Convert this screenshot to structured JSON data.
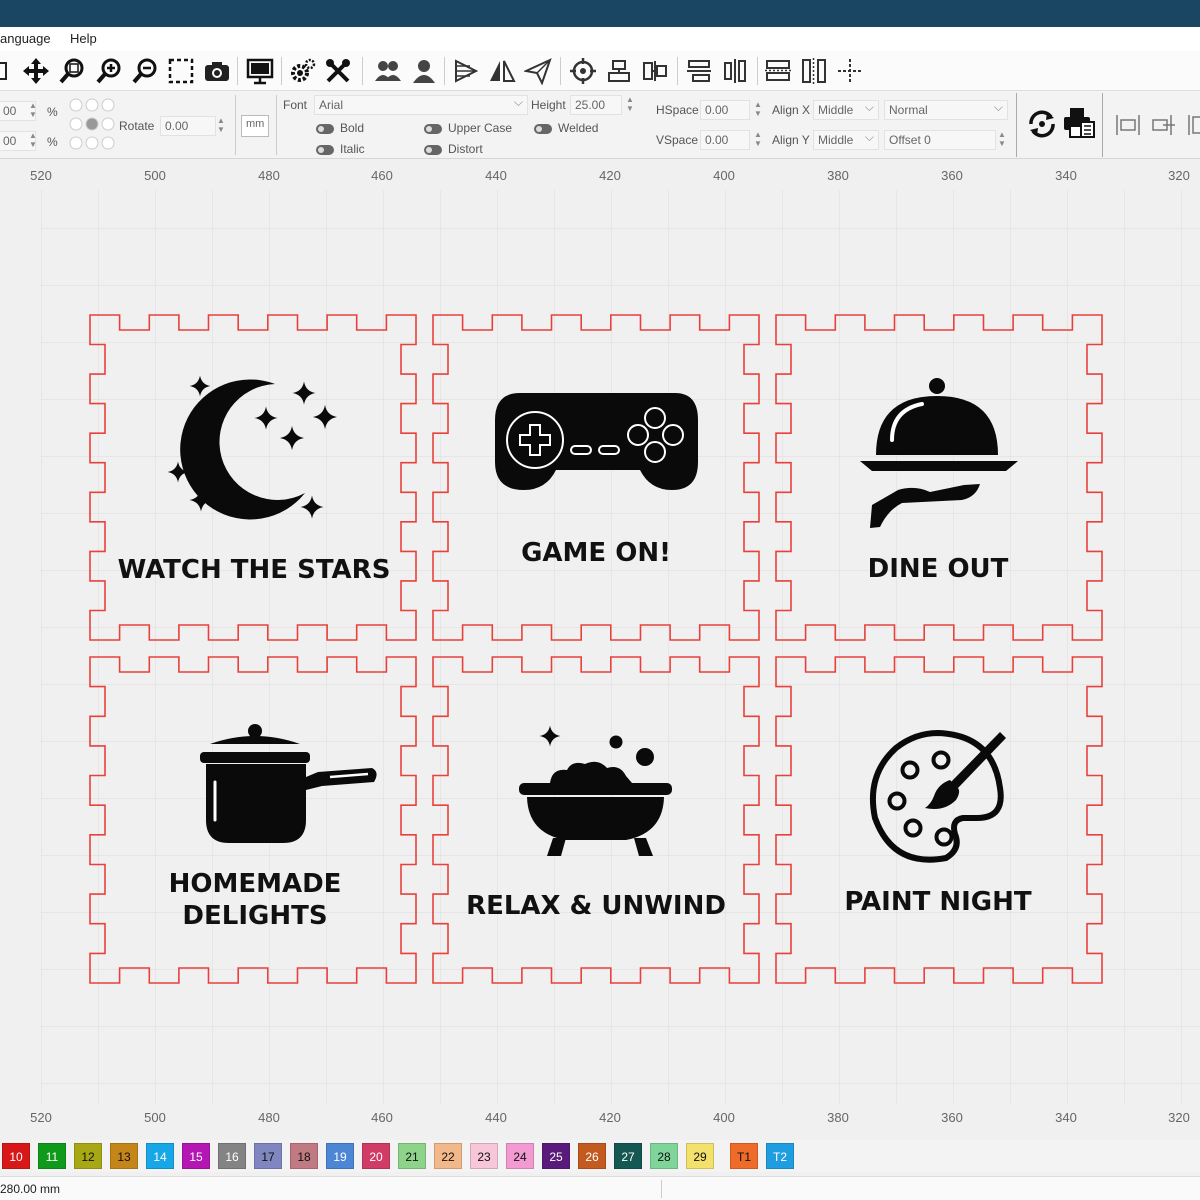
{
  "menu": {
    "language": "anguage",
    "help": "Help"
  },
  "toolbar": {
    "icons": [
      "open-icon",
      "move-icon",
      "zoom-fit-icon",
      "zoom-in-icon",
      "zoom-out-icon",
      "select-rect-icon",
      "camera-icon",
      "monitor-icon",
      "settings-icon",
      "tools-icon",
      "group-icon",
      "user-icon",
      "flip-horizontal-icon",
      "mirror-icon",
      "send-icon",
      "target-icon",
      "align-top-icon",
      "align-side-icon",
      "distribute-h-icon",
      "distribute-v-icon",
      "array-icon",
      "spacing-icon",
      "crosshair-icon"
    ]
  },
  "textbar": {
    "pos_x": "00",
    "pos_y": "00",
    "pct1": "%",
    "pct2": "%",
    "rotate_label": "Rotate",
    "rotate_value": "0.00",
    "unit": "mm",
    "font_label": "Font",
    "font_value": "Arial",
    "height_label": "Height",
    "height_value": "25.00",
    "hspace_label": "HSpace",
    "hspace_value": "0.00",
    "vspace_label": "VSpace",
    "vspace_value": "0.00",
    "alignx_label": "Align X",
    "alignx_value": "Middle",
    "aligny_label": "Align Y",
    "aligny_value": "Middle",
    "mode_value": "Normal",
    "offset_label": "Offset",
    "offset_value": "0",
    "bold": "Bold",
    "italic": "Italic",
    "upper_case": "Upper Case",
    "distort": "Distort",
    "welded": "Welded"
  },
  "ruler": {
    "ticks": [
      "520",
      "500",
      "480",
      "460",
      "440",
      "420",
      "400",
      "380",
      "360",
      "340",
      "320"
    ]
  },
  "cards": [
    {
      "title": "WATCH THE STARS",
      "icon": "moon-stars-icon"
    },
    {
      "title": "GAME ON!",
      "icon": "gamepad-icon"
    },
    {
      "title": "DINE OUT",
      "icon": "cloche-icon"
    },
    {
      "title_line1": "HOMEMADE",
      "title_line2": "DELIGHTS",
      "icon": "cooking-pot-icon"
    },
    {
      "title": "RELAX & UNWIND",
      "icon": "bathtub-icon"
    },
    {
      "title": "PAINT NIGHT",
      "icon": "palette-icon"
    }
  ],
  "colors": {
    "cut_line": "#e8413c",
    "icon_fill": "#0a0a0a",
    "titlebar": "#1a4563"
  },
  "palette": [
    {
      "label": "10",
      "color": "#d81818",
      "fg": "#fff"
    },
    {
      "label": "11",
      "color": "#0f9a1b",
      "fg": "#fff"
    },
    {
      "label": "12",
      "color": "#a8a814",
      "fg": "#111"
    },
    {
      "label": "13",
      "color": "#c4861a",
      "fg": "#111"
    },
    {
      "label": "14",
      "color": "#17a7e6",
      "fg": "#fff"
    },
    {
      "label": "15",
      "color": "#b316b3",
      "fg": "#fff"
    },
    {
      "label": "16",
      "color": "#848484",
      "fg": "#fff"
    },
    {
      "label": "17",
      "color": "#7f86c0",
      "fg": "#111"
    },
    {
      "label": "18",
      "color": "#c07a82",
      "fg": "#111"
    },
    {
      "label": "19",
      "color": "#4e86d6",
      "fg": "#fff"
    },
    {
      "label": "20",
      "color": "#d13c66",
      "fg": "#fff"
    },
    {
      "label": "21",
      "color": "#8dd389",
      "fg": "#111"
    },
    {
      "label": "22",
      "color": "#f2b889",
      "fg": "#111"
    },
    {
      "label": "23",
      "color": "#f7c6d9",
      "fg": "#111"
    },
    {
      "label": "24",
      "color": "#f39ad3",
      "fg": "#111"
    },
    {
      "label": "25",
      "color": "#5a1a7c",
      "fg": "#fff"
    },
    {
      "label": "26",
      "color": "#c35a1f",
      "fg": "#fff"
    },
    {
      "label": "27",
      "color": "#145753",
      "fg": "#fff"
    },
    {
      "label": "28",
      "color": "#7fd49a",
      "fg": "#111"
    },
    {
      "label": "29",
      "color": "#f3e16b",
      "fg": "#111"
    },
    {
      "label": "T1",
      "color": "#ef6b29",
      "fg": "#111"
    },
    {
      "label": "T2",
      "color": "#1e9ee0",
      "fg": "#fff"
    }
  ],
  "status": {
    "coord": "280.00 mm"
  }
}
